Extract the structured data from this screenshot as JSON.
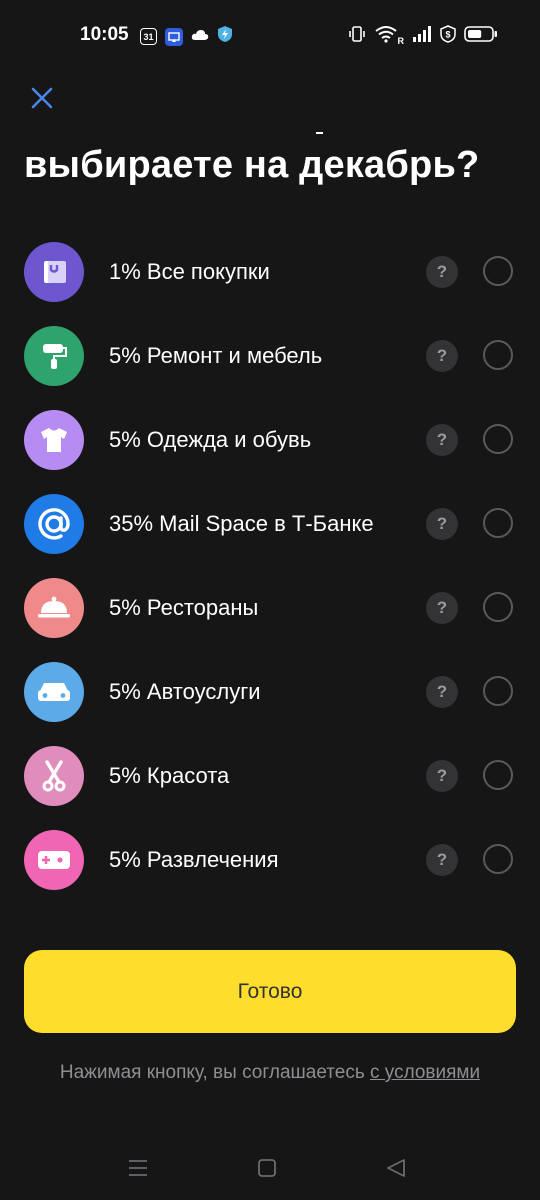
{
  "status_bar": {
    "time": "10:05",
    "calendar_icon_text": "31",
    "icons_left": [
      "calendar-icon",
      "cast-icon",
      "cloud-icon",
      "shield-bolt-icon"
    ],
    "icons_right": [
      "vibrate-icon",
      "wifi-icon",
      "signal-icon",
      "dollar-shield-icon",
      "battery-icon"
    ],
    "network_label": "R",
    "battery_level": 0.6
  },
  "header": {
    "title": "выбираете на декабрь?"
  },
  "options": [
    {
      "label": "1% Все покупки",
      "icon": "shopping-bag-icon",
      "color": "#6e56cf"
    },
    {
      "label": "5% Ремонт и мебель",
      "icon": "paint-roller-icon",
      "color": "#2ea36c"
    },
    {
      "label": "5% Одежда и обувь",
      "icon": "tshirt-icon",
      "color": "#b78cf2"
    },
    {
      "label": "35% Mail Space в Т-Банке",
      "icon": "at-sign-icon",
      "color": "#1f7be6"
    },
    {
      "label": "5% Рестораны",
      "icon": "cloche-icon",
      "color": "#f08a8a"
    },
    {
      "label": "5% Автоуслуги",
      "icon": "car-icon",
      "color": "#5cabe8"
    },
    {
      "label": "5% Красота",
      "icon": "scissors-icon",
      "color": "#e08cbc"
    },
    {
      "label": "5% Развлечения",
      "icon": "gamepad-icon",
      "color": "#f066b4"
    }
  ],
  "help_label": "?",
  "actions": {
    "done_label": "Готово"
  },
  "terms": {
    "text": "Нажимая кнопку, вы соглашаетесь ",
    "link": "с условиями"
  },
  "nav": [
    "menu-icon",
    "home-icon",
    "back-icon"
  ]
}
